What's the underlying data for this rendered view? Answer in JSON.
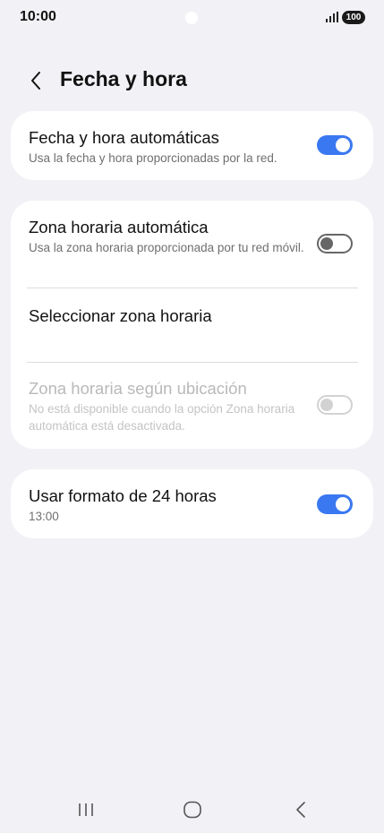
{
  "status_bar": {
    "time": "10:00",
    "battery": "100",
    "signal_icon": "signal-bars-icon"
  },
  "header": {
    "title": "Fecha y hora",
    "back_icon": "chevron-left-icon"
  },
  "settings": {
    "auto_datetime": {
      "title": "Fecha y hora automáticas",
      "subtitle": "Usa la fecha y hora proporcionadas por la red.",
      "enabled": true
    },
    "auto_timezone": {
      "title": "Zona horaria automática",
      "subtitle": "Usa la zona horaria proporcionada por tu red móvil.",
      "enabled": false
    },
    "select_timezone": {
      "title": "Seleccionar zona horaria"
    },
    "location_timezone": {
      "title": "Zona horaria según ubicación",
      "subtitle": "No está disponible cuando la opción Zona horaria automática está desactivada.",
      "enabled": false,
      "disabled": true
    },
    "format_24h": {
      "title": "Usar formato de 24 horas",
      "subtitle": "13:00",
      "enabled": true
    }
  },
  "colors": {
    "accent": "#3a78f2",
    "background": "#f2f2f6",
    "card": "#ffffff"
  },
  "nav_bar": {
    "recents_icon": "recents-icon",
    "home_icon": "home-icon",
    "back_icon": "back-icon"
  }
}
